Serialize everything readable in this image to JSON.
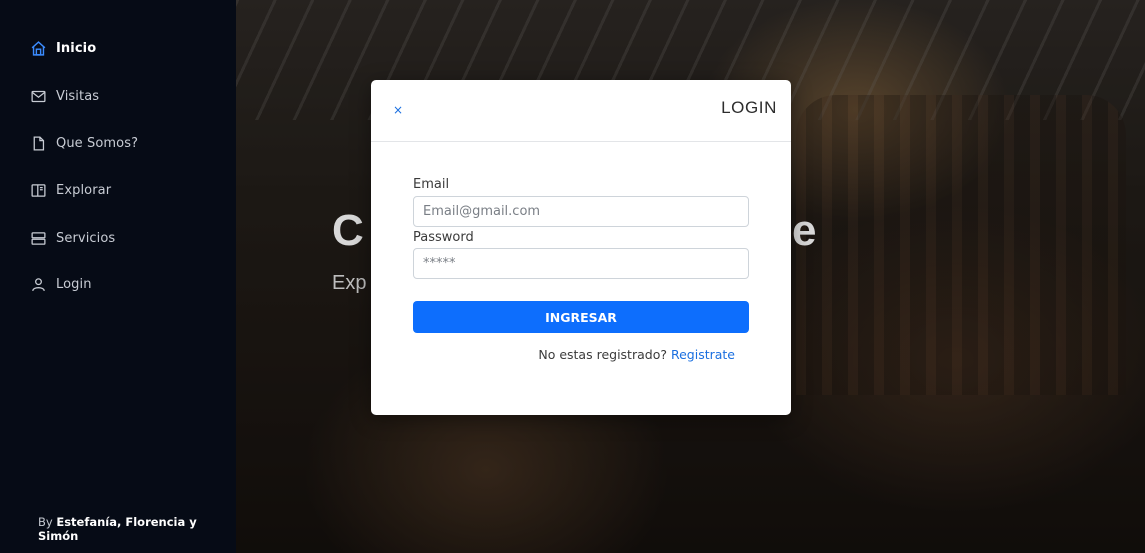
{
  "sidebar": {
    "items": [
      {
        "label": "Inicio",
        "icon": "home-icon",
        "active": true
      },
      {
        "label": "Visitas",
        "icon": "mail-icon",
        "active": false
      },
      {
        "label": "Que Somos?",
        "icon": "file-icon",
        "active": false
      },
      {
        "label": "Explorar",
        "icon": "layout-icon",
        "active": false
      },
      {
        "label": "Servicios",
        "icon": "server-icon",
        "active": false
      },
      {
        "label": "Login",
        "icon": "user-icon",
        "active": false
      }
    ],
    "footer_prefix": "By ",
    "footer_authors": "Estefanía, Florencia y Simón"
  },
  "hero": {
    "title_start": "C",
    "title_end": "e",
    "subtitle": "Exp"
  },
  "modal": {
    "close": "×",
    "title": "LOGIN",
    "email_label": "Email",
    "email_placeholder": "Email@gmail.com",
    "password_label": "Password",
    "password_placeholder": "*****",
    "submit_label": "INGRESAR",
    "register_text": "No estas registrado?",
    "register_link": "Registrate"
  },
  "colors": {
    "accent": "#0d6efd",
    "sidebar_bg": "#060b16",
    "active_icon": "#3b8cff"
  }
}
